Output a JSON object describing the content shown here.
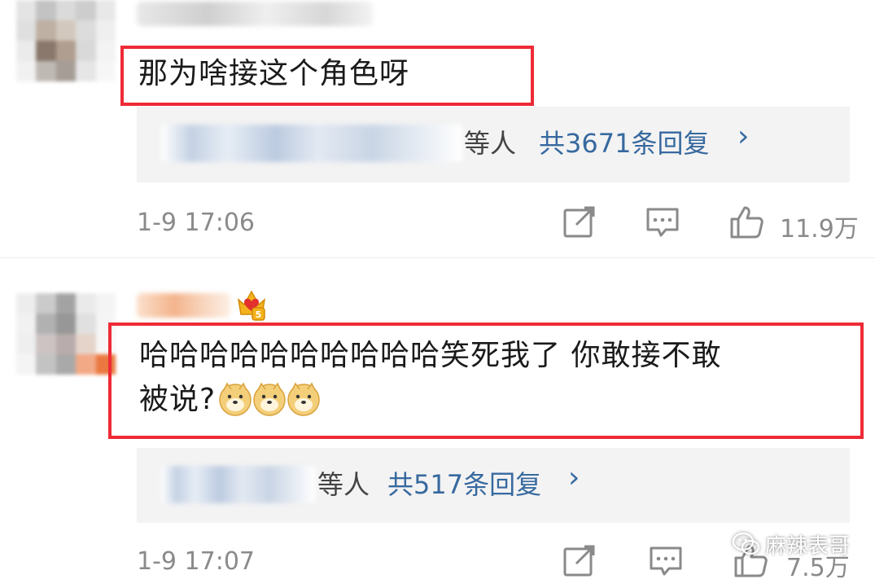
{
  "comments": [
    {
      "text": "那为啥接这个角色呀",
      "reply_others": "等人",
      "reply_total": "共3671条回复",
      "reply_chevron": "›",
      "timestamp": "1-9 17:06",
      "likes": "11.9万"
    },
    {
      "text_line1": "哈哈哈哈哈哈哈哈哈哈笑死我了 你敢接不敢",
      "text_line2": "被说?",
      "emoji_names": [
        "doge-emoji",
        "doge-emoji",
        "doge-emoji"
      ],
      "reply_others": "等人",
      "reply_total": "共517条回复",
      "reply_chevron": "›",
      "timestamp": "1-9 17:07",
      "likes": "7.5万"
    }
  ],
  "icons": {
    "share": "share-icon",
    "comment": "comment-icon",
    "like": "thumbs-up-icon",
    "crown": "vip-crown-icon",
    "wechat": "wechat-icon"
  },
  "watermark": {
    "text": "麻辣表哥"
  },
  "colors": {
    "highlight_border": "#ee2b36",
    "link_blue": "#37699f",
    "meta_gray": "#8a8a8a",
    "reply_bg": "#f3f3f3"
  }
}
